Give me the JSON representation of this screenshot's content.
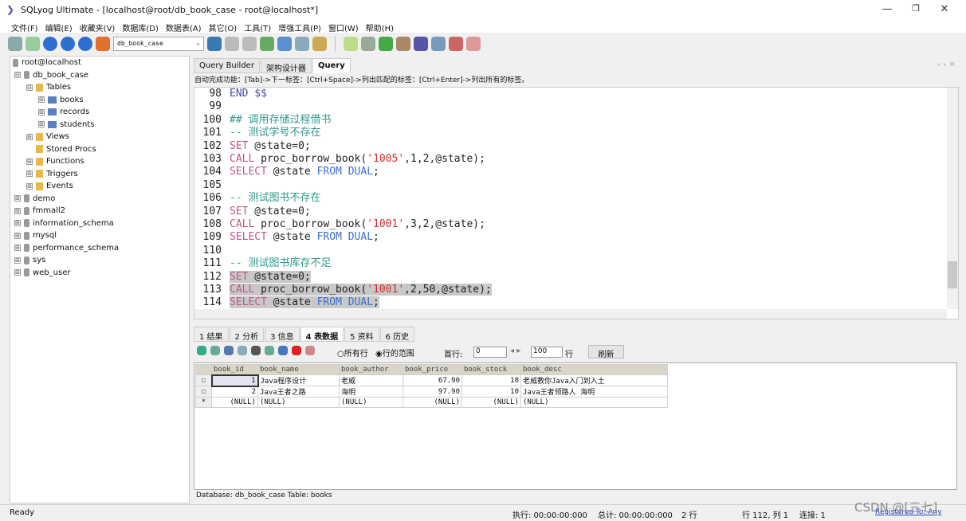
{
  "window": {
    "title": "SQLyog Ultimate - [localhost@root/db_book_case - root@localhost*]",
    "minimize": "—",
    "maximize": "❐",
    "close": "✕"
  },
  "menu": [
    "文件(F)",
    "编辑(E)",
    "收藏夹(V)",
    "数据库(D)",
    "数据表(A)",
    "其它(O)",
    "工具(T)",
    "增强工具(P)",
    "窗口(W)",
    "帮助(H)"
  ],
  "toolbar": {
    "db_select": "db_book_case"
  },
  "tree": {
    "root": "root@localhost",
    "db": "db_book_case",
    "tables": "Tables",
    "table_items": [
      "books",
      "records",
      "students"
    ],
    "folders": [
      "Views",
      "Stored Procs",
      "Functions",
      "Triggers",
      "Events"
    ],
    "databases": [
      "demo",
      "fmmall2",
      "information_schema",
      "mysql",
      "performance_schema",
      "sys",
      "web_user"
    ]
  },
  "editor_tabs": [
    "Query Builder",
    "架构设计器",
    "Query"
  ],
  "hint": "自动完成功能：[Tab]->下一标签：[Ctrl+Space]->列出匹配的标签：[Ctrl+Enter]->列出所有的标签。",
  "code": [
    {
      "n": "98",
      "sel": false,
      "tokens": [
        [
          "END $$",
          "k2"
        ]
      ]
    },
    {
      "n": "99",
      "sel": false,
      "tokens": []
    },
    {
      "n": "100",
      "sel": false,
      "tokens": [
        [
          "## 调用存储过程借书",
          "c"
        ]
      ]
    },
    {
      "n": "101",
      "sel": false,
      "tokens": [
        [
          "-- 测试学号不存在",
          "c"
        ]
      ]
    },
    {
      "n": "102",
      "sel": false,
      "tokens": [
        [
          "SET",
          "k"
        ],
        [
          " @state=0;",
          "p"
        ]
      ]
    },
    {
      "n": "103",
      "sel": false,
      "tokens": [
        [
          "CALL",
          "k"
        ],
        [
          " proc_borrow_book(",
          "p"
        ],
        [
          "'1005'",
          "s"
        ],
        [
          ",1,2,@state);",
          "p"
        ]
      ]
    },
    {
      "n": "104",
      "sel": false,
      "tokens": [
        [
          "SELECT",
          "k"
        ],
        [
          " @state ",
          "p"
        ],
        [
          "FROM DUAL",
          "b"
        ],
        [
          ";",
          "p"
        ]
      ]
    },
    {
      "n": "105",
      "sel": false,
      "tokens": []
    },
    {
      "n": "106",
      "sel": false,
      "tokens": [
        [
          "-- 测试图书不存在",
          "c"
        ]
      ]
    },
    {
      "n": "107",
      "sel": false,
      "tokens": [
        [
          "SET",
          "k"
        ],
        [
          " @state=0;",
          "p"
        ]
      ]
    },
    {
      "n": "108",
      "sel": false,
      "tokens": [
        [
          "CALL",
          "k"
        ],
        [
          " proc_borrow_book(",
          "p"
        ],
        [
          "'1001'",
          "s"
        ],
        [
          ",3,2,@state);",
          "p"
        ]
      ]
    },
    {
      "n": "109",
      "sel": false,
      "tokens": [
        [
          "SELECT",
          "k"
        ],
        [
          " @state ",
          "p"
        ],
        [
          "FROM DUAL",
          "b"
        ],
        [
          ";",
          "p"
        ]
      ]
    },
    {
      "n": "110",
      "sel": false,
      "tokens": []
    },
    {
      "n": "111",
      "sel": false,
      "tokens": [
        [
          "-- 测试图书库存不足",
          "c"
        ]
      ]
    },
    {
      "n": "112",
      "sel": true,
      "tokens": [
        [
          "SET",
          "k"
        ],
        [
          " @state=0;",
          "p"
        ]
      ]
    },
    {
      "n": "113",
      "sel": true,
      "tokens": [
        [
          "CALL",
          "k"
        ],
        [
          " proc_borrow_book(",
          "p"
        ],
        [
          "'1001'",
          "s"
        ],
        [
          ",2,50,@state);",
          "p"
        ]
      ]
    },
    {
      "n": "114",
      "sel": true,
      "tokens": [
        [
          "SELECT",
          "k"
        ],
        [
          " @state ",
          "p"
        ],
        [
          "FROM DUAL",
          "b"
        ],
        [
          ";",
          "p"
        ]
      ]
    }
  ],
  "colors": {
    "k": "#c0558a",
    "k2": "#4a4ab0",
    "b": "#3d6fd0",
    "s": "#d03030",
    "c": "#2e9a8e",
    "p": "#222222"
  },
  "result_tabs": [
    "1 结果",
    "2 分析",
    "3 信息",
    "4 表数据",
    "5 资料",
    "6 历史"
  ],
  "result_toolbar": {
    "all_rows": "所有行",
    "row_range": "行的范围",
    "first_row_label": "首行:",
    "first_row": "0",
    "count": "100",
    "rows_unit": "行",
    "refresh": "刷新"
  },
  "grid": {
    "columns": [
      "book_id",
      "book_name",
      "book_author",
      "book_price",
      "book_stock",
      "book_desc"
    ],
    "rows": [
      [
        "1",
        "Java程序设计",
        "老威",
        "67.90",
        "18",
        "老威教你Java入门到入土"
      ],
      [
        "2",
        "Java王者之路",
        "海明",
        "97.90",
        "10",
        "Java王者领路人 海明"
      ],
      [
        "(NULL)",
        "(NULL)",
        "(NULL)",
        "(NULL)",
        "(NULL)",
        "(NULL)"
      ]
    ]
  },
  "footer": "Database: db_book_case Table: books",
  "status": {
    "ready": "Ready",
    "exec": "执行: 00:00:00:000",
    "total": "总计: 00:00:00:000",
    "rows": "2 行",
    "pos": "行 112, 列 1",
    "conn": "连接: 1",
    "registered": "Registered To: Any",
    "watermark": "CSDN @[三七]"
  }
}
